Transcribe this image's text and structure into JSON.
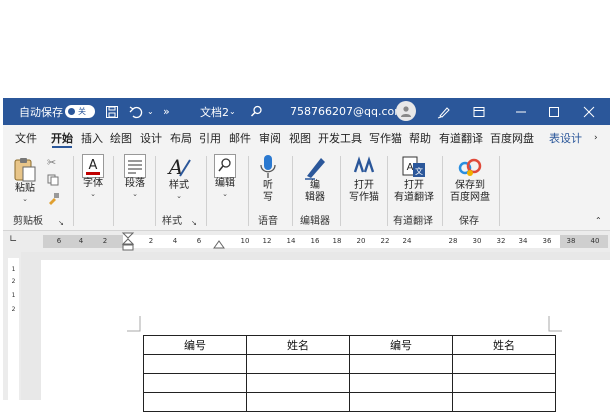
{
  "titlebar": {
    "autosave_label": "自动保存",
    "autosave_state": "关",
    "doc_title": "文档2",
    "user": "758766207@qq.com",
    "more": "»"
  },
  "tabs": [
    {
      "label": "文件"
    },
    {
      "label": "开始"
    },
    {
      "label": "插入"
    },
    {
      "label": "绘图"
    },
    {
      "label": "设计"
    },
    {
      "label": "布局"
    },
    {
      "label": "引用"
    },
    {
      "label": "邮件"
    },
    {
      "label": "审阅"
    },
    {
      "label": "视图"
    },
    {
      "label": "开发工具"
    },
    {
      "label": "写作猫"
    },
    {
      "label": "帮助"
    },
    {
      "label": "有道翻译"
    },
    {
      "label": "百度网盘"
    },
    {
      "label": "表设计"
    }
  ],
  "ribbon": {
    "paste": "粘贴",
    "clipboard": "剪贴板",
    "font": "字体",
    "paragraph": "段落",
    "styles": "样式",
    "styles_group": "样式",
    "editing": "编辑",
    "listen_1": "听",
    "listen_2": "写",
    "voice_group": "语音",
    "editor_1": "编",
    "editor_2": "辑器",
    "editor_group": "编辑器",
    "xzm_1": "打开",
    "xzm_2": "写作猫",
    "youdao_1": "打开",
    "youdao_2": "有道翻译",
    "youdao_group": "有道翻译",
    "baidu_1": "保存到",
    "baidu_2": "百度网盘",
    "save_group": "保存"
  },
  "ruler": {
    "ticks": [
      "6",
      "4",
      "2",
      "2",
      "4",
      "6",
      "10",
      "12",
      "14",
      "16",
      "18",
      "20",
      "22",
      "24",
      "28",
      "30",
      "32",
      "34",
      "36",
      "38",
      "40"
    ]
  },
  "vruler": {
    "ticks": [
      "1",
      "2",
      "1",
      "2"
    ]
  },
  "table": {
    "header": [
      "编号",
      "姓名",
      "编号",
      "姓名"
    ]
  },
  "colors": {
    "titlebar": "#2b579a",
    "ribbon": "#f3f3f3",
    "accent": "#2b579a"
  }
}
